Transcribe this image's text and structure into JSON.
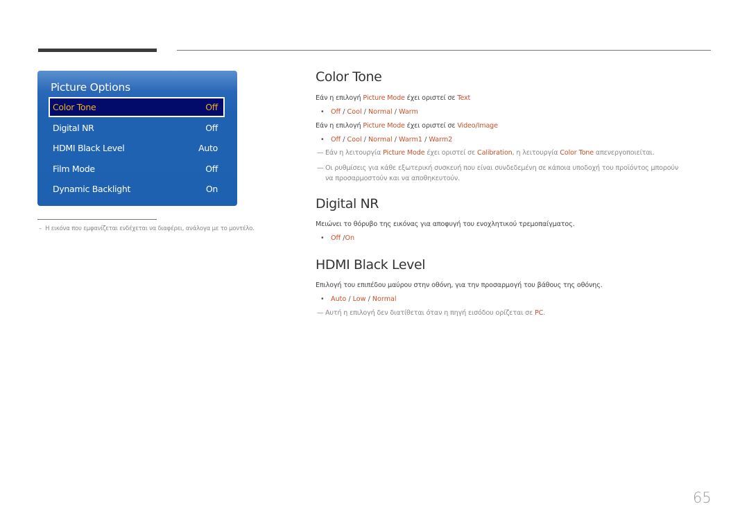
{
  "panel": {
    "title": "Picture Options",
    "items": [
      {
        "label": "Color Tone",
        "value": "Off",
        "selected": true
      },
      {
        "label": "Digital NR",
        "value": "Off"
      },
      {
        "label": "HDMI Black Level",
        "value": "Auto"
      },
      {
        "label": "Film Mode",
        "value": "Off"
      },
      {
        "label": "Dynamic Backlight",
        "value": "On"
      }
    ]
  },
  "footnote": {
    "dash": "–",
    "text": "Η εικόνα που εμφανίζεται ενδέχεται να διαφέρει, ανάλογα με το μοντέλο."
  },
  "sections": {
    "color_tone": {
      "title": "Color Tone",
      "line1": {
        "pre": "Εάν η επιλογή ",
        "hl1": "Picture Mode",
        "mid": " έχει οριστεί σε ",
        "hl2": "Text"
      },
      "opts1": [
        "Off",
        "Cool",
        "Normal",
        "Warm"
      ],
      "line2": {
        "pre": "Εάν η επιλογή ",
        "hl1": "Picture Mode",
        "mid": " έχει οριστεί σε ",
        "hl2": "Video/Image"
      },
      "opts2": [
        "Off",
        "Cool",
        "Normal",
        "Warm1",
        "Warm2"
      ],
      "note1": {
        "pre": "Εάν η λειτουργία ",
        "hl1": "Picture Mode",
        "mid": " έχει οριστεί σε ",
        "hl2": "Calibration",
        "mid2": ", η λειτουργία ",
        "hl3": "Color Tone",
        "post": " απενεργοποιείται."
      },
      "note2": {
        "line1": "Οι ρυθμίσεις για κάθε εξωτερική συσκευή που είναι συνδεδεμένη σε κάποια υποδοχή του προϊόντος μπορούν",
        "line2": "να προσαρμοστούν και να αποθηκευτούν."
      }
    },
    "digital_nr": {
      "title": "Digital NR",
      "desc": "Μειώνει το θόρυβο της εικόνας για αποφυγή του ενοχλητικού τρεμοπαίγματος.",
      "opts": [
        "Off",
        "On"
      ]
    },
    "hdmi_black": {
      "title": "HDMI Black Level",
      "desc": "Επιλογή του επιπέδου μαύρου στην οθόνη, για την προσαρμογή του βάθους της οθόνης.",
      "opts": [
        "Auto",
        "Low",
        "Normal"
      ],
      "note": {
        "pre": "Αυτή η επιλογή δεν διατίθεται όταν η πηγή εισόδου ορίζεται σε ",
        "hl": "PC",
        "post": "."
      }
    }
  },
  "symbols": {
    "bullet": "•",
    "note_dash": "—",
    "slash": " / ",
    "slash_tight": " /"
  },
  "page_number": "65"
}
